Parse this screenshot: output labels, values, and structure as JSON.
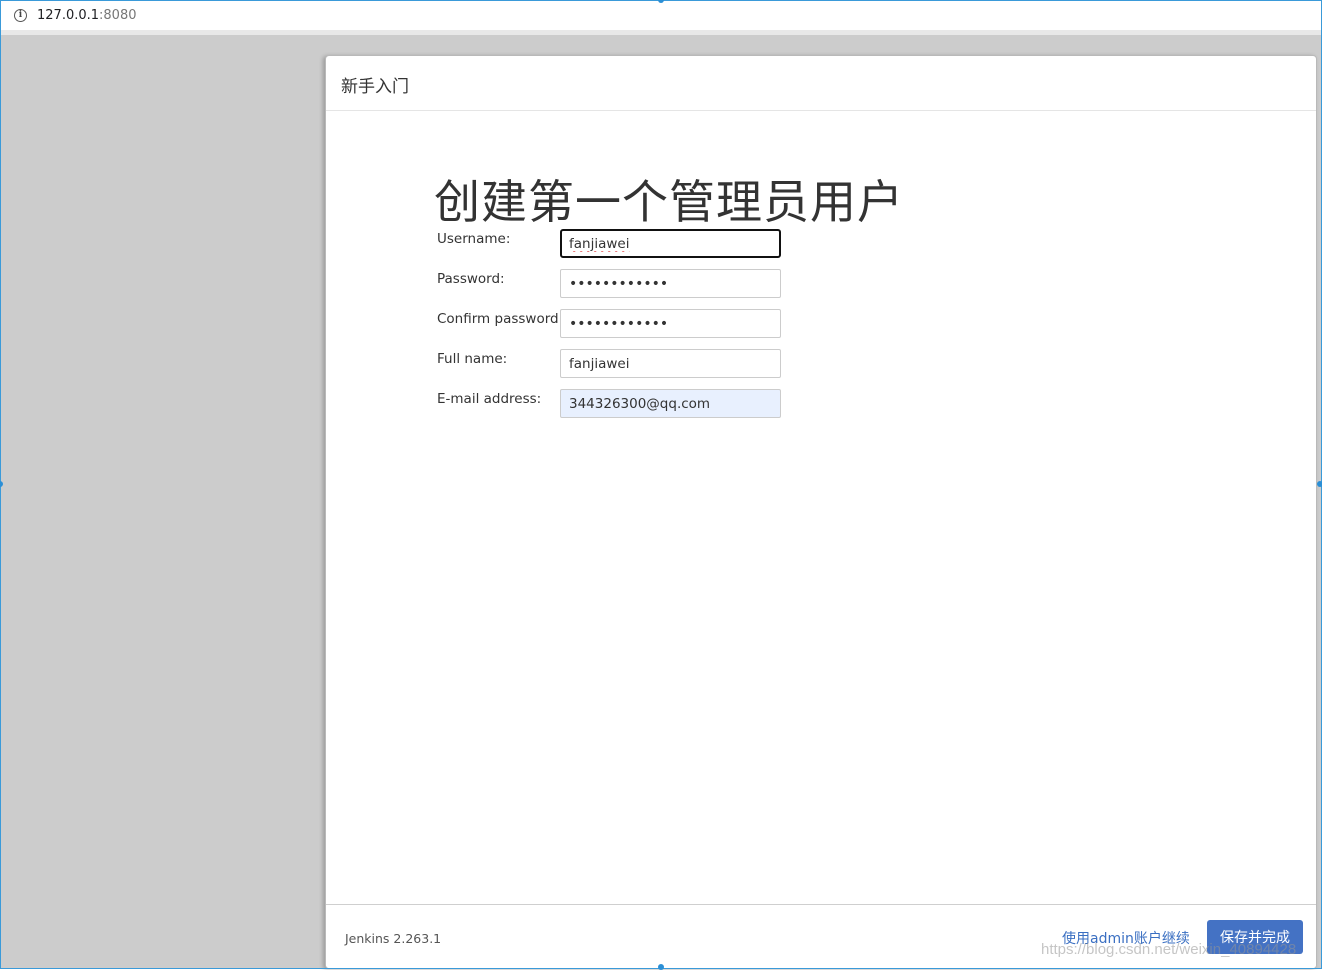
{
  "browser": {
    "url_host": "127.0.0.1",
    "url_port": ":8080",
    "info_icon": "info-icon"
  },
  "dialog": {
    "title": "新手入门",
    "heading": "创建第一个管理员用户",
    "fields": {
      "username": {
        "label": "Username:",
        "value": "fanjiawei"
      },
      "password": {
        "label": "Password:",
        "value": "••••••••••••"
      },
      "confirm_password": {
        "label": "Confirm password:",
        "value": "••••••••••••"
      },
      "full_name": {
        "label": "Full name:",
        "value": "fanjiawei"
      },
      "email": {
        "label": "E-mail address:",
        "value": "344326300@qq.com"
      }
    },
    "footer": {
      "version": "Jenkins 2.263.1",
      "skip_label": "使用admin账户继续",
      "save_label": "保存并完成"
    }
  },
  "watermark": "https://blog.csdn.net/weixin_40894428",
  "colors": {
    "primary_button": "#4472c4",
    "link": "#3a6fc2",
    "backdrop": "#cccccc",
    "autofill": "#e8f0fe"
  }
}
